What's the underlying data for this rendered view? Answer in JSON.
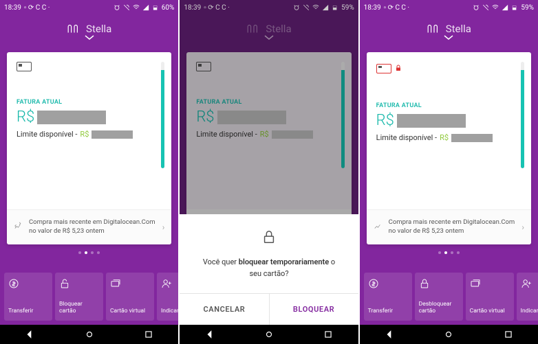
{
  "status": {
    "time": "18:39",
    "battery_left": "60%",
    "battery_mid": "59%",
    "battery_right": "59%"
  },
  "header": {
    "name": "Stella"
  },
  "card": {
    "fatura_label": "FATURA ATUAL",
    "currency": "R$",
    "limit_label": "Limite disponível -",
    "limit_currency": "R$",
    "tx_text": "Compra mais recente em Digitalocean.Com no valor de R$ 5,23 ontem"
  },
  "actions_locked": {
    "a1": "Transferir",
    "a2": "Bloquear cartão",
    "a3": "Cartão virtual",
    "a4": "Indicar amigo"
  },
  "actions_unlocked": {
    "a1": "Transferir",
    "a2": "Desbloquear cartão",
    "a3": "Cartão virtual",
    "a4": "Indicar amigo"
  },
  "dialog": {
    "q_pre": "Você quer ",
    "q_bold": "bloquear temporariamente",
    "q_post": " o seu cartão?",
    "cancel": "CANCELAR",
    "confirm": "BLOQUEAR"
  }
}
